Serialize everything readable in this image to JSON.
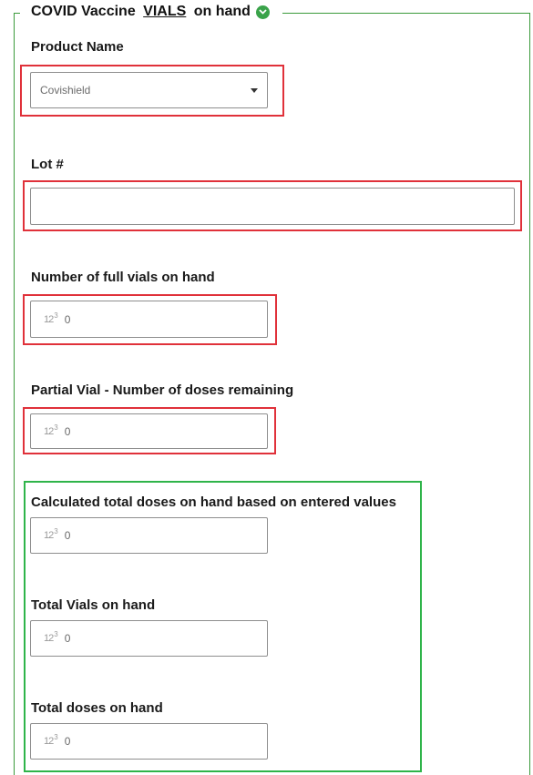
{
  "section": {
    "legend_prefix": "COVID Vaccine ",
    "legend_emphasis": "VIALS",
    "legend_suffix": " on hand",
    "toggle_icon": "chevron-down-icon",
    "accent_color": "#3aa34a"
  },
  "product": {
    "label": "Product Name",
    "selected_value": "Covishield"
  },
  "lot": {
    "label": "Lot #",
    "value": ""
  },
  "full_vials": {
    "label": "Number of full vials on hand",
    "value": "0"
  },
  "partial_vial": {
    "label": "Partial Vial - Number of doses remaining",
    "value": "0"
  },
  "calculated_total": {
    "label": "Calculated total doses on hand based on entered values",
    "value": "0"
  },
  "total_vials": {
    "label": "Total Vials on hand",
    "value": "0"
  },
  "total_doses": {
    "label": "Total doses on hand",
    "value": "0"
  },
  "number_icon": {
    "name": "number-input-icon",
    "digits": "12",
    "superscript": "3"
  },
  "highlight_colors": {
    "required": "#e0313a",
    "calculated": "#2fb44a"
  }
}
